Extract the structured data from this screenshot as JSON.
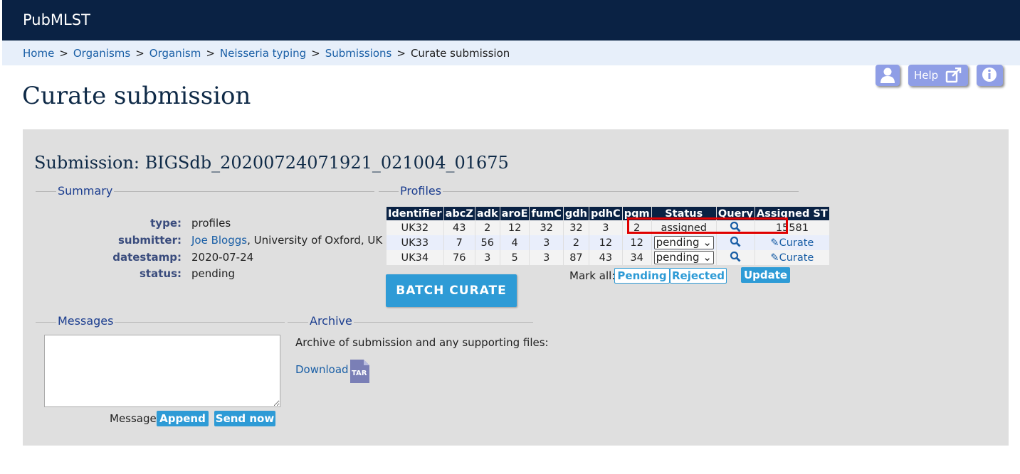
{
  "header": {
    "brand": "PubMLST"
  },
  "breadcrumb": [
    {
      "label": "Home"
    },
    {
      "label": "Organisms"
    },
    {
      "label": "Organism"
    },
    {
      "label": "Neisseria typing"
    },
    {
      "label": "Submissions"
    },
    {
      "label": "Curate submission",
      "current": true
    }
  ],
  "toolbar": {
    "help_label": "Help"
  },
  "page": {
    "title": "Curate submission"
  },
  "submission": {
    "title": "Submission: BIGSdb_20200724071921_021004_01675"
  },
  "summary": {
    "legend": "Summary",
    "type_key": "type:",
    "type_val": "profiles",
    "submitter_key": "submitter:",
    "submitter_name": "Joe Bloggs",
    "submitter_org": ", University of Oxford, UK",
    "datestamp_key": "datestamp:",
    "datestamp_val": "2020-07-24",
    "status_key": "status:",
    "status_val": "pending"
  },
  "profiles": {
    "legend": "Profiles",
    "columns": [
      "Identifier",
      "abcZ",
      "adk",
      "aroE",
      "fumC",
      "gdh",
      "pdhC",
      "pgm",
      "Status",
      "Query",
      "Assigned ST"
    ],
    "rows": [
      {
        "id": "UK32",
        "v": [
          "43",
          "2",
          "12",
          "32",
          "32",
          "3",
          "2"
        ],
        "status": "assigned",
        "assigned": "15581"
      },
      {
        "id": "UK33",
        "v": [
          "7",
          "56",
          "4",
          "3",
          "2",
          "12",
          "12"
        ],
        "status": "pending",
        "assigned": "Curate"
      },
      {
        "id": "UK34",
        "v": [
          "76",
          "3",
          "5",
          "3",
          "87",
          "43",
          "34"
        ],
        "status": "pending",
        "assigned": "Curate"
      }
    ],
    "mark_all_label": "Mark all:",
    "pending_btn": "Pending",
    "rejected_btn": "Rejected",
    "update_btn": "Update",
    "batch_curate": "BATCH CURATE"
  },
  "messages": {
    "legend": "Messages",
    "message_label": "Message:",
    "append_btn": "Append",
    "send_btn": "Send now"
  },
  "archive": {
    "legend": "Archive",
    "text": "Archive of submission and any supporting files:",
    "download": "Download",
    "file_badge": "TAR"
  },
  "colors": {
    "header": "#0a2244",
    "accent": "#2e9bd6",
    "highlight": "#e00000"
  }
}
